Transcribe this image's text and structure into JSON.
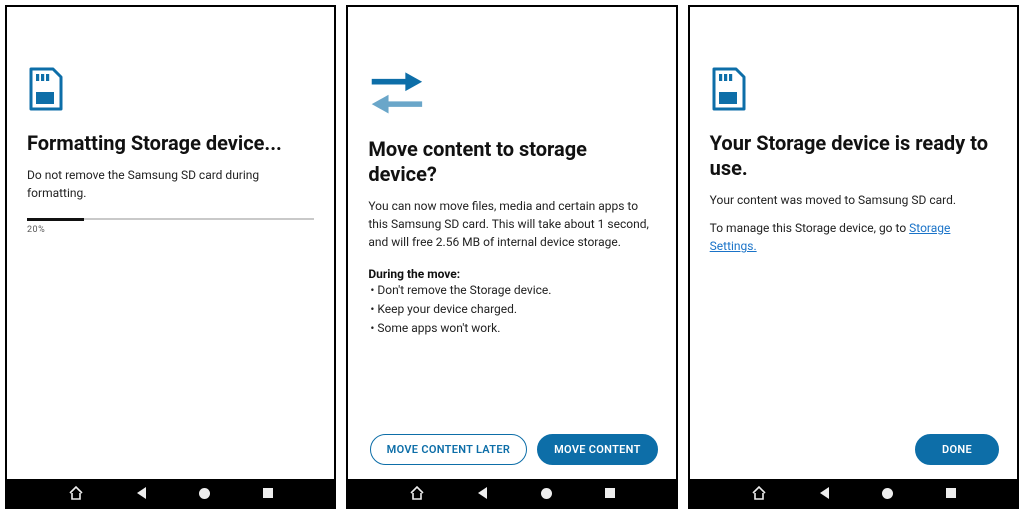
{
  "screen1": {
    "title": "Formatting Storage device...",
    "subtext": "Do not remove the Samsung SD card during formatting.",
    "progress_percent": 20,
    "progress_label": "20%"
  },
  "screen2": {
    "title": "Move content to storage device?",
    "body": "You can now move files, media and certain apps to this Samsung SD card. This will take about 1 second, and will free 2.56 MB of internal device storage.",
    "during_heading": "During the move:",
    "bullets": [
      "Don't remove the Storage device.",
      "Keep your device charged.",
      "Some apps won't work."
    ],
    "btn_later": "MOVE CONTENT LATER",
    "btn_move": "MOVE CONTENT"
  },
  "screen3": {
    "title": "Your Storage device is ready to use.",
    "line1": "Your content was moved to Samsung SD card.",
    "line2_prefix": "To manage this Storage device, go to ",
    "link_text": "Storage Settings.",
    "btn_done": "DONE"
  }
}
